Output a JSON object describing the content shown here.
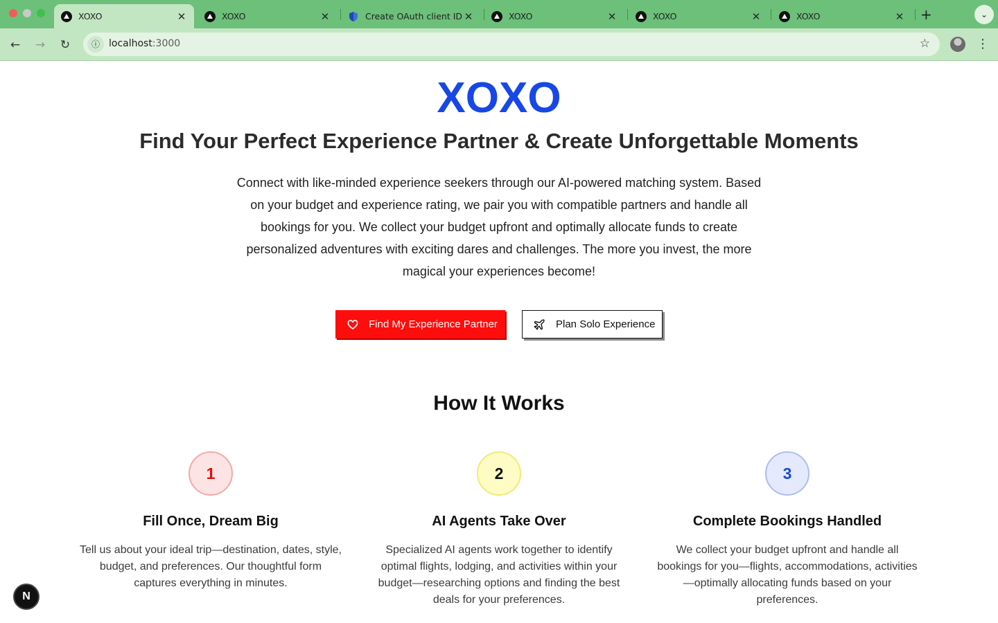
{
  "browser": {
    "tabs": [
      {
        "title": "XOXO",
        "active": true,
        "icon": "triangle-favicon"
      },
      {
        "title": "XOXO",
        "active": false,
        "icon": "triangle-favicon"
      },
      {
        "title": "Create OAuth client ID –",
        "active": false,
        "icon": "shield-favicon"
      },
      {
        "title": "XOXO",
        "active": false,
        "icon": "triangle-favicon"
      },
      {
        "title": "XOXO",
        "active": false,
        "icon": "triangle-favicon"
      },
      {
        "title": "XOXO",
        "active": false,
        "icon": "triangle-favicon"
      }
    ],
    "url_host": "localhost",
    "url_port": ":3000",
    "colors": {
      "tabbar": "#6cc07a",
      "toolbar": "#c3e6c2"
    }
  },
  "hero": {
    "logo": "XOXO",
    "headline": "Find Your Perfect Experience Partner & Create Unforgettable Moments",
    "intro": "Connect with like-minded experience seekers through our AI-powered matching system. Based on your budget and experience rating, we pair you with compatible partners and handle all bookings for you. We collect your budget upfront and optimally allocate funds to create personalized adventures with exciting dares and challenges. The more you invest, the more magical your experiences become!",
    "primary_button": "Find My Experience Partner",
    "secondary_button": "Plan Solo Experience",
    "colors": {
      "brand": "#1747e6",
      "primary_button": "#ff0d0d"
    }
  },
  "how_it_works": {
    "title": "How It Works",
    "steps": [
      {
        "number": "1",
        "title": "Fill Once, Dream Big",
        "description": "Tell us about your ideal trip—destination, dates, style, budget, and preferences. Our thoughtful form captures everything in minutes."
      },
      {
        "number": "2",
        "title": "AI Agents Take Over",
        "description": "Specialized AI agents work together to identify optimal flights, lodging, and activities within your budget—researching options and finding the best deals for your preferences."
      },
      {
        "number": "3",
        "title": "Complete Bookings Handled",
        "description": "We collect your budget upfront and handle all bookings for you—flights, accommodations, activities—optimally allocating funds based on your preferences."
      }
    ]
  },
  "dev_badge": {
    "label": "N"
  }
}
